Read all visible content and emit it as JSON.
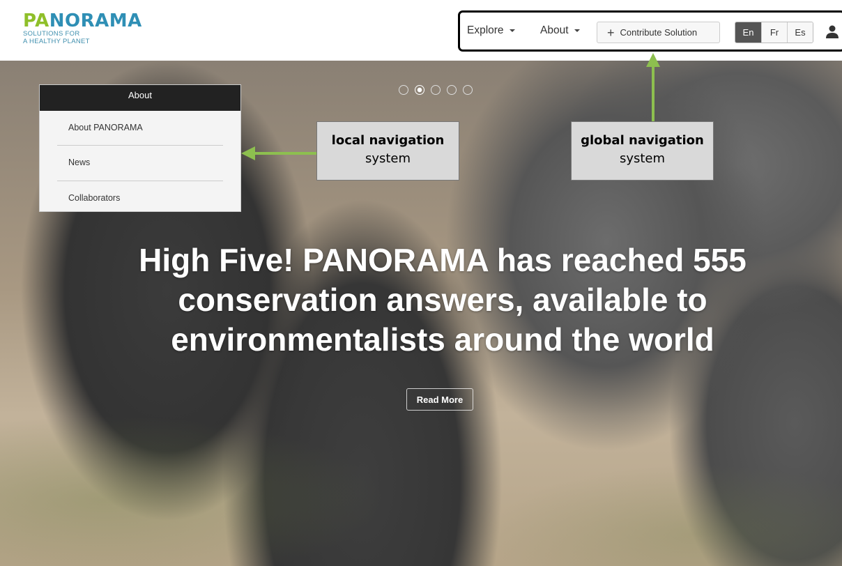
{
  "logo": {
    "word_a": "PA",
    "word_b": "NORAMA",
    "tagline_1": "SOLUTIONS FOR",
    "tagline_2": "A HEALTHY PLANET"
  },
  "global_nav": {
    "explore_label": "Explore",
    "about_label": "About",
    "contribute_label": "Contribute Solution",
    "languages": [
      "En",
      "Fr",
      "Es"
    ],
    "active_language": "En"
  },
  "local_nav": {
    "header": "About",
    "items": [
      {
        "label": "About PANORAMA"
      },
      {
        "label": "News"
      },
      {
        "label": "Collaborators"
      }
    ]
  },
  "hero": {
    "headline_1": "High Five! PANORAMA has reached 555",
    "headline_2": "conservation answers, available to",
    "headline_3": "environmentalists around the world",
    "read_more_label": "Read More",
    "slide_count": 5,
    "active_slide": 2
  },
  "annotations": {
    "local": {
      "bold": "local navigation",
      "plain": "system"
    },
    "global": {
      "bold": "global navigation",
      "plain": "system"
    }
  },
  "colors": {
    "arrow": "#8dbf4f",
    "logo_green": "#8fbf2a",
    "logo_blue": "#2f8fb5"
  },
  "icons": [
    "plus-icon",
    "user-icon",
    "chevron-down-icon",
    "arrow-left-icon",
    "arrow-up-icon"
  ]
}
